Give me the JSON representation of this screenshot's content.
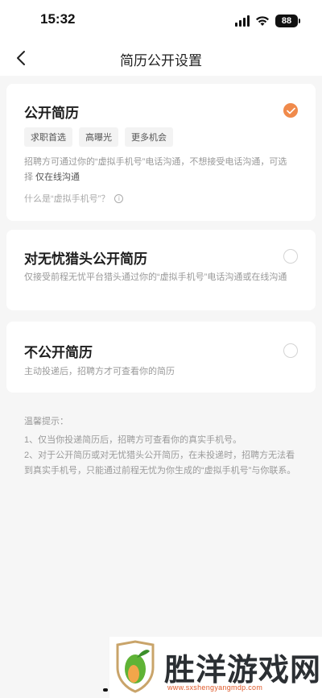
{
  "status_bar": {
    "time": "15:32",
    "battery": "88"
  },
  "header": {
    "title": "简历公开设置"
  },
  "options": [
    {
      "title": "公开简历",
      "selected": true,
      "tags": [
        "求职首选",
        "高曝光",
        "更多机会"
      ],
      "description_pre": "招聘方可通过你的“虚拟手机号”电话沟通，不想接受电话沟通，可选择",
      "description_highlight": " 仅在线沟通",
      "what_is": "什么是“虚拟手机号”？"
    },
    {
      "title": "对无忧猎头公开简历",
      "selected": false,
      "description": "仅接受前程无忧平台猎头通过你的“虚拟手机号”电话沟通或在线沟通"
    },
    {
      "title": "不公开简历",
      "selected": false,
      "description": "主动投递后，招聘方才可查看你的简历"
    }
  ],
  "tips": {
    "heading": "温馨提示：",
    "items": [
      "1、仅当你投递简历后，招聘方可查看你的真实手机号。",
      "2、对于公开简历或对无忧猎头公开简历，在未投递时，招聘方无法看到真实手机号，只能通过前程无忧为你生成的“虚拟手机号”与你联系。"
    ]
  },
  "watermark": {
    "title": "胜洋游戏网",
    "url": "www.sxshengyangmdp.com"
  },
  "colors": {
    "accent": "#f08a4b",
    "background": "#f6f6f6"
  }
}
